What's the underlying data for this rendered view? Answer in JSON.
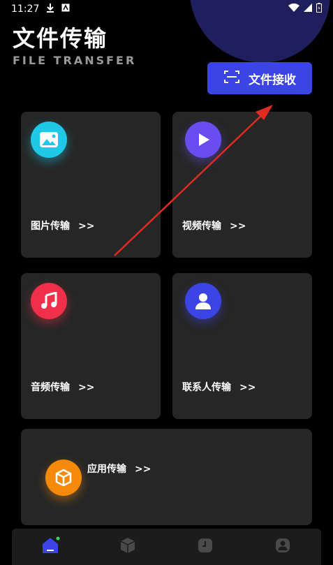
{
  "status_bar": {
    "time": "11:27"
  },
  "header": {
    "title": "文件传输",
    "subtitle": "FILE TRANSFER"
  },
  "receive_button": {
    "label": "文件接收",
    "icon": "scan-icon",
    "color": "#3b45e6"
  },
  "cards": [
    {
      "label": "图片传输",
      "arrows": ">>",
      "icon": "image-icon",
      "color": "#1ec8e6"
    },
    {
      "label": "视频传输",
      "arrows": ">>",
      "icon": "play-icon",
      "color": "#6a4df0"
    },
    {
      "label": "音频传输",
      "arrows": ">>",
      "icon": "music-icon",
      "color": "#f0304a"
    },
    {
      "label": "联系人传输",
      "arrows": ">>",
      "icon": "contact-icon",
      "color": "#3b45e6"
    },
    {
      "label": "应用传输",
      "arrows": ">>",
      "icon": "app-box-icon",
      "color": "#f58a0a"
    }
  ],
  "bottom_nav": [
    {
      "icon": "home-icon",
      "active": true
    },
    {
      "icon": "box-icon",
      "active": false
    },
    {
      "icon": "clock-icon",
      "active": false
    },
    {
      "icon": "profile-icon",
      "active": false
    }
  ]
}
